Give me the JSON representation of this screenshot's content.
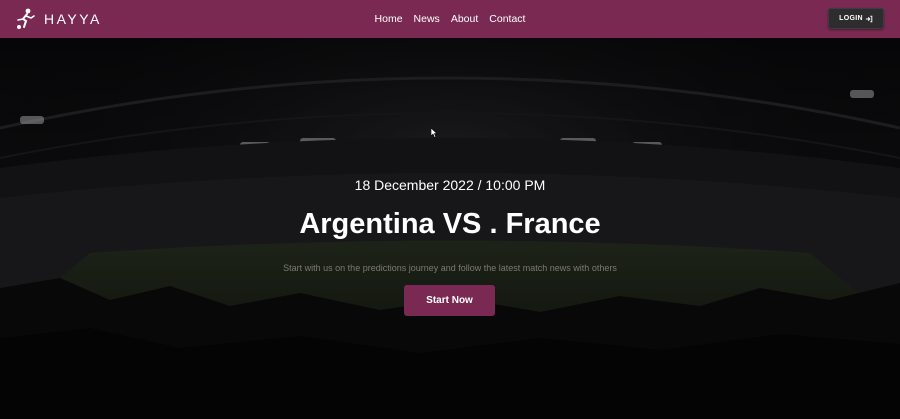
{
  "brand": {
    "name": "HAYYA",
    "logo_icon": "footballer-icon"
  },
  "nav": {
    "items": [
      {
        "label": "Home"
      },
      {
        "label": "News"
      },
      {
        "label": "About"
      },
      {
        "label": "Contact"
      }
    ]
  },
  "login": {
    "label": "LOGIN",
    "icon": "login-arrow-icon"
  },
  "hero": {
    "date": "18 December 2022 / 10:00 PM",
    "title": "Argentina VS . France",
    "subtitle": "Start with us on the predictions journey and follow the latest match news with others",
    "cta_label": "Start Now"
  },
  "colors": {
    "brand": "#7a2a52",
    "login_bg": "#2d2d30",
    "subtitle": "#7b7a74"
  }
}
